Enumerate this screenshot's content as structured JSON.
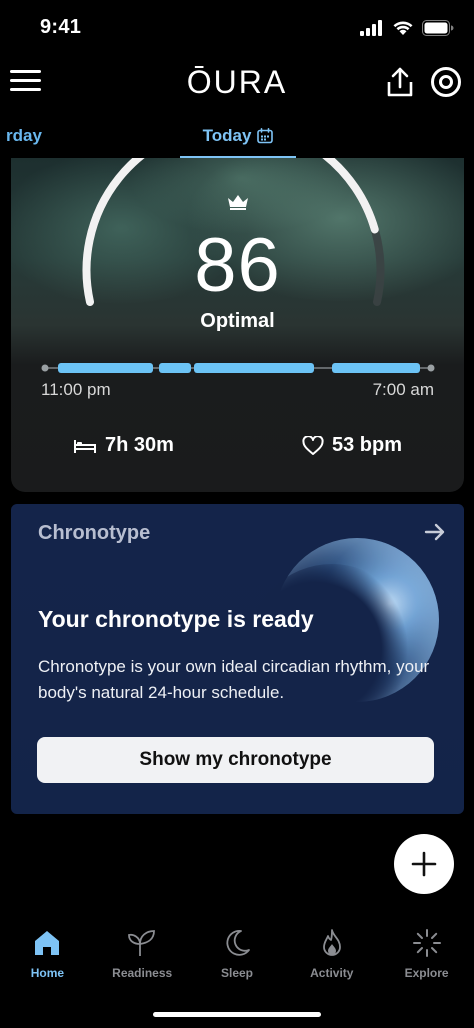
{
  "status_bar": {
    "time": "9:41"
  },
  "header": {
    "logo_text": "ŌURA"
  },
  "date_tabs": {
    "previous": "rday",
    "current": "Today"
  },
  "sleep_card": {
    "score": "86",
    "score_label": "Optimal",
    "score_fraction": 0.86,
    "start_time": "11:00 pm",
    "end_time": "7:00 am",
    "duration": "7h 30m",
    "heart_rate": "53 bpm"
  },
  "chronotype_card": {
    "title": "Chronotype",
    "heading": "Your chronotype is ready",
    "description": "Chronotype is your own ideal circadian rhythm, your body's natural 24-hour schedule.",
    "button_label": "Show my chronotype"
  },
  "bottom_nav": {
    "items": [
      {
        "label": "Home",
        "icon": "home-icon",
        "active": true
      },
      {
        "label": "Readiness",
        "icon": "sprout-icon",
        "active": false
      },
      {
        "label": "Sleep",
        "icon": "moon-icon",
        "active": false
      },
      {
        "label": "Activity",
        "icon": "flame-icon",
        "active": false
      },
      {
        "label": "Explore",
        "icon": "sparkle-icon",
        "active": false
      }
    ]
  },
  "colors": {
    "accent": "#7ec3f5",
    "background": "#000000",
    "card_blue": "#14244a"
  }
}
